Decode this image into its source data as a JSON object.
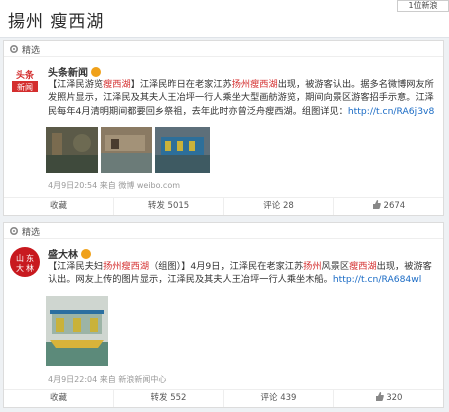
{
  "header": {
    "title": "揚州 瘦西湖",
    "badge": "1位新浪"
  },
  "posts": [
    {
      "label": "精选",
      "author": "头条新闻",
      "avatar_text": "头条新闻",
      "body_prefix": "【江泽民游览",
      "body_hl1": "瘦西湖",
      "body_mid1": "】江泽民昨日在老家江苏",
      "body_hl2": "扬州瘦西湖",
      "body_rest": "出现，被游客认出。据多名微博网友所发照片显示，江泽民及其夫人王冶坪一行人乘坐大型画舫游览，期间向景区游客招手示意。江泽民每年4月清明期间都要回乡祭祖，去年此时亦曾泛舟瘦西湖。组图详见：",
      "link": "http://t.cn/RA6j3v8",
      "meta": "4月9日20:54 来自 微博 weibo.com",
      "actions": {
        "fav": "收藏",
        "repost": "转发",
        "repost_count": "5015",
        "comment": "评论",
        "comment_count": "28",
        "like_count": "2674"
      }
    },
    {
      "label": "精选",
      "author": "盛大林",
      "avatar_text": "山东大林",
      "body_prefix": "【江泽民夫妇",
      "body_hl1": "扬州瘦西湖",
      "body_mid1": "（组图）】4月9日，江泽民在老家江苏",
      "body_hl2": "扬州",
      "body_mid2": "风景区",
      "body_hl3": "瘦西湖",
      "body_rest": "出现，被游客认出。网友上传的图片显示，江泽民及其夫人王冶坪一行人乘坐木船。",
      "link": "http://t.cn/RA684wl",
      "meta": "4月9日22:04 来自 新浪新闻中心",
      "actions": {
        "fav": "收藏",
        "repost": "转发",
        "repost_count": "552",
        "comment": "评论",
        "comment_count": "439",
        "like_count": "320"
      }
    }
  ]
}
